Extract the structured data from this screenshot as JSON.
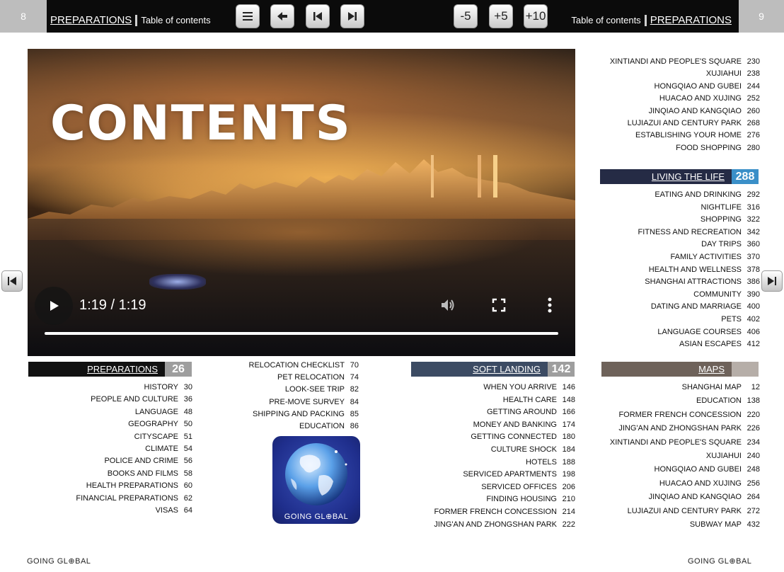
{
  "header": {
    "left_page": "8",
    "right_page": "9",
    "left_section_link": "PREPARATIONS",
    "left_section_title": "Table of contents",
    "right_section_title": "Table of contents",
    "right_section_link": "PREPARATIONS",
    "toolbar": {
      "menu_icon": "hamburger-icon",
      "back_icon": "arrow-left-icon",
      "first_icon": "skip-back-icon",
      "last_icon": "skip-forward-icon",
      "minus5": "-5",
      "plus5": "+5",
      "plus10": "+10"
    }
  },
  "video": {
    "title_text": "CONTENTS",
    "time": "1:19 / 1:19",
    "progress": 1.0
  },
  "preparations": {
    "label": "PREPARATIONS",
    "page": "26",
    "color": "#111111",
    "items": [
      {
        "t": "HISTORY",
        "p": "30"
      },
      {
        "t": "PEOPLE AND CULTURE",
        "p": "36"
      },
      {
        "t": "LANGUAGE",
        "p": "48"
      },
      {
        "t": "GEOGRAPHY",
        "p": "50"
      },
      {
        "t": "CITYSCAPE",
        "p": "51"
      },
      {
        "t": "CLIMATE",
        "p": "54"
      },
      {
        "t": "POLICE AND CRIME",
        "p": "56"
      },
      {
        "t": "BOOKS AND FILMS",
        "p": "58"
      },
      {
        "t": "HEALTH PREPARATIONS",
        "p": "60"
      },
      {
        "t": "FINANCIAL PREPARATIONS",
        "p": "62"
      },
      {
        "t": "VISAS",
        "p": "64"
      }
    ]
  },
  "preparations_cont": {
    "items": [
      {
        "t": "RELOCATION CHECKLIST",
        "p": "70"
      },
      {
        "t": "PET RELOCATION",
        "p": "74"
      },
      {
        "t": "LOOK-SEE TRIP",
        "p": "82"
      },
      {
        "t": "PRE-MOVE SURVEY",
        "p": "84"
      },
      {
        "t": "SHIPPING AND PACKING",
        "p": "85"
      },
      {
        "t": "EDUCATION",
        "p": "86"
      }
    ]
  },
  "logo": {
    "text": "GOING GL⊕BAL"
  },
  "soft_landing": {
    "label": "SOFT LANDING",
    "page": "142",
    "color": "#3c4b63",
    "items": [
      {
        "t": "WHEN YOU ARRIVE",
        "p": "146"
      },
      {
        "t": "HEALTH CARE",
        "p": "148"
      },
      {
        "t": "GETTING AROUND",
        "p": "166"
      },
      {
        "t": "MONEY AND BANKING",
        "p": "174"
      },
      {
        "t": "GETTING CONNECTED",
        "p": "180"
      },
      {
        "t": "CULTURE SHOCK",
        "p": "184"
      },
      {
        "t": "HOTELS",
        "p": "188"
      },
      {
        "t": "SERVICED APARTMENTS",
        "p": "198"
      },
      {
        "t": "SERVICED OFFICES",
        "p": "206"
      },
      {
        "t": "FINDING HOUSING",
        "p": "210"
      },
      {
        "t": "FORMER FRENCH CONCESSION",
        "p": "214"
      },
      {
        "t": "JING'AN AND ZHONGSHAN PARK",
        "p": "222"
      }
    ]
  },
  "right_top": {
    "items": [
      {
        "t": "XINTIANDI AND PEOPLE'S SQUARE",
        "p": "230"
      },
      {
        "t": "XUJIAHUI",
        "p": "238"
      },
      {
        "t": "HONGQIAO AND GUBEI",
        "p": "244"
      },
      {
        "t": "HUACAO AND XUJING",
        "p": "252"
      },
      {
        "t": "JINQIAO AND KANGQIAO",
        "p": "260"
      },
      {
        "t": "LUJIAZUI AND CENTURY PARK",
        "p": "268"
      },
      {
        "t": "ESTABLISHING YOUR HOME",
        "p": "276"
      },
      {
        "t": "FOOD SHOPPING",
        "p": "280"
      }
    ]
  },
  "living": {
    "label": "LIVING THE LIFE",
    "page": "288",
    "color": "#252b45",
    "num_color": "#3a8fc8",
    "items": [
      {
        "t": "EATING AND DRINKING",
        "p": "292"
      },
      {
        "t": "NIGHTLIFE",
        "p": "316"
      },
      {
        "t": "SHOPPING",
        "p": "322"
      },
      {
        "t": "FITNESS AND RECREATION",
        "p": "342"
      },
      {
        "t": "DAY TRIPS",
        "p": "360"
      },
      {
        "t": "FAMILY ACTIVITIES",
        "p": "370"
      },
      {
        "t": "HEALTH AND WELLNESS",
        "p": "378"
      },
      {
        "t": "SHANGHAI ATTRACTIONS",
        "p": "386"
      },
      {
        "t": "COMMUNITY",
        "p": "390"
      },
      {
        "t": "DATING AND MARRIAGE",
        "p": "400"
      },
      {
        "t": "PETS",
        "p": "402"
      },
      {
        "t": "LANGUAGE COURSES",
        "p": "406"
      },
      {
        "t": "ASIAN ESCAPES",
        "p": "412"
      }
    ]
  },
  "maps": {
    "label": "MAPS",
    "color": "#6e625a",
    "items": [
      {
        "t": "SHANGHAI MAP",
        "p": "12"
      },
      {
        "t": "EDUCATION",
        "p": "138"
      },
      {
        "t": "FORMER FRENCH CONCESSION",
        "p": "220"
      },
      {
        "t": "JING'AN AND ZHONGSHAN PARK",
        "p": "226"
      },
      {
        "t": "XINTIANDI AND PEOPLE'S SQUARE",
        "p": "234"
      },
      {
        "t": "XUJIAHUI",
        "p": "240"
      },
      {
        "t": "HONGQIAO AND GUBEI",
        "p": "248"
      },
      {
        "t": "HUACAO AND XUJING",
        "p": "256"
      },
      {
        "t": "JINQIAO AND KANGQIAO",
        "p": "264"
      },
      {
        "t": "LUJIAZUI AND CENTURY PARK",
        "p": "272"
      },
      {
        "t": "SUBWAY MAP",
        "p": "432"
      }
    ]
  },
  "footer": {
    "left": "GOING GL⊕BAL",
    "right": "GOING GL⊕BAL"
  }
}
